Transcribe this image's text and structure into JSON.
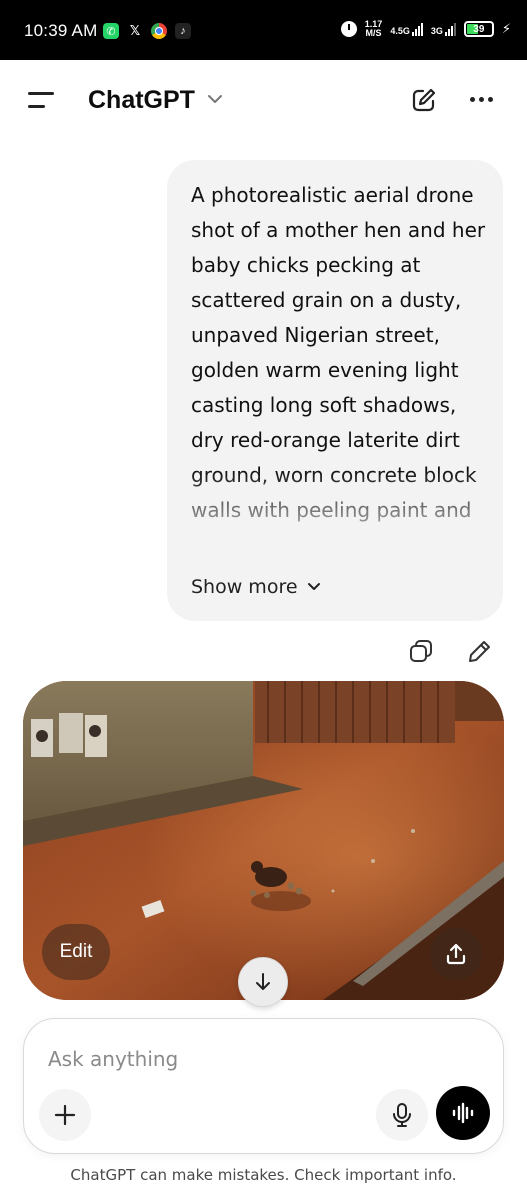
{
  "status_bar": {
    "time": "10:39 AM",
    "notification_icons": [
      "whatsapp-icon",
      "x-icon",
      "chrome-icon",
      "tiktok-icon"
    ],
    "speed_value": "1.17",
    "speed_unit": "M/S",
    "network_primary": "4.5G",
    "network_secondary": "3G",
    "battery_level": "39"
  },
  "header": {
    "title": "ChatGPT"
  },
  "conversation": {
    "user_message": "A photorealistic aerial drone shot of a mother hen and her baby chicks pecking at scattered grain on a dusty, unpaved Nigerian street, golden warm evening light casting long soft shadows, dry red-orange laterite dirt ground, worn concrete block walls with peeling paint and",
    "show_more_label": "Show more",
    "image_edit_label": "Edit"
  },
  "composer": {
    "placeholder": "Ask anything"
  },
  "footer": {
    "disclaimer": "ChatGPT can make mistakes. Check important info."
  },
  "colors": {
    "status_bar_bg": "#000000",
    "bubble_bg": "#f3f3f3",
    "battery_fill": "#3ddc5a",
    "whatsapp": "#25d366"
  }
}
